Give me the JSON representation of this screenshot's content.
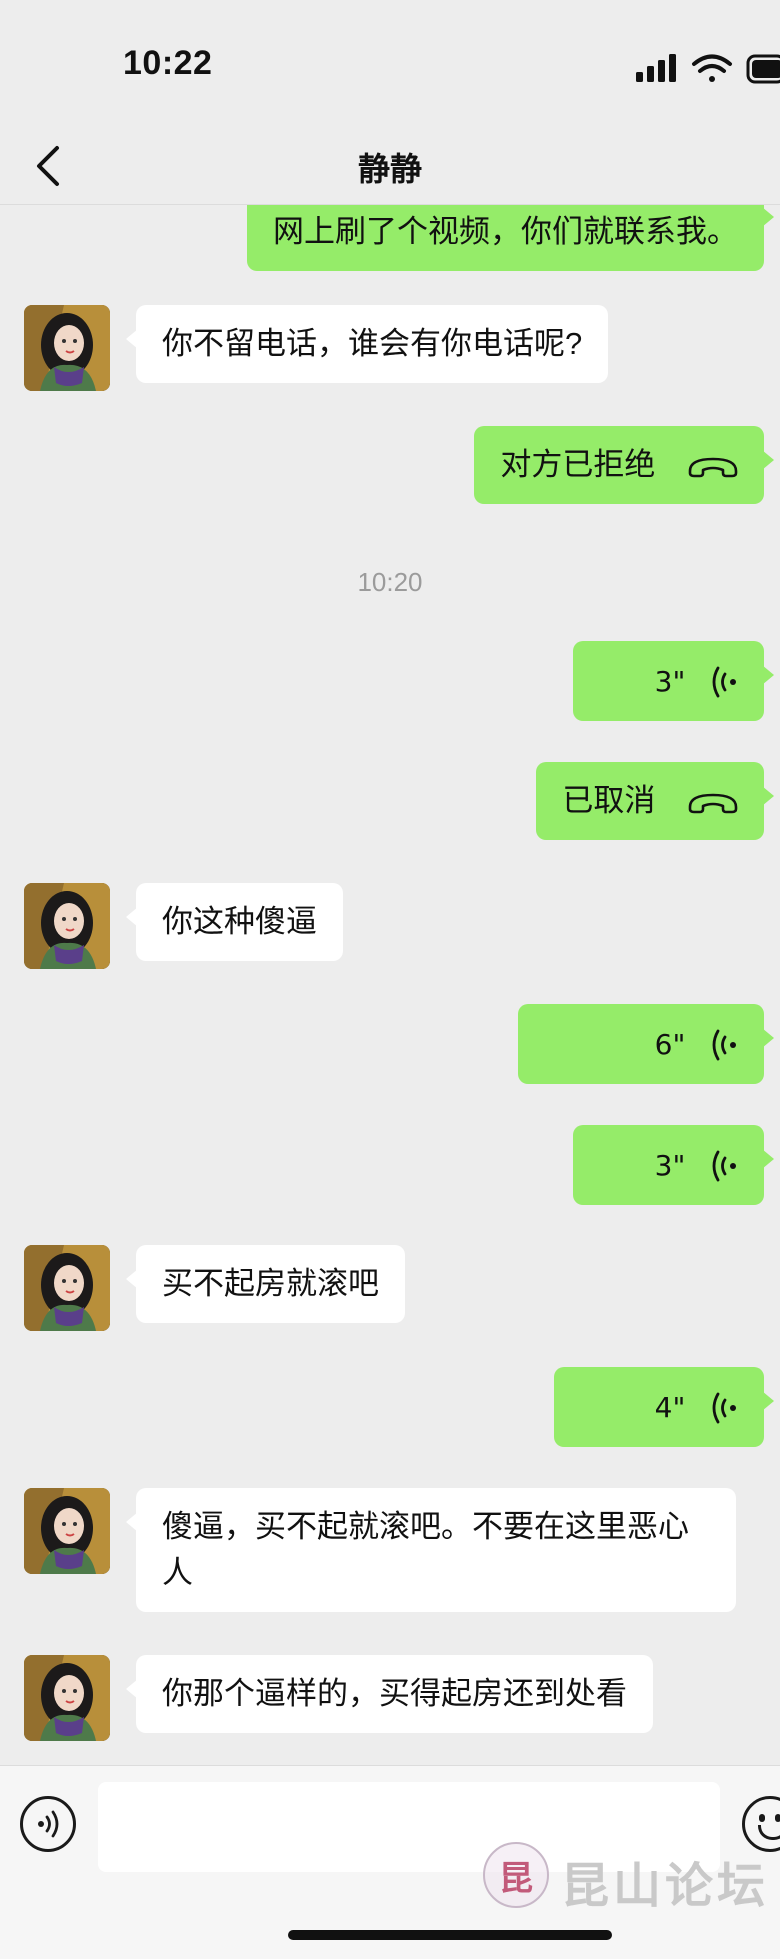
{
  "status_bar": {
    "time": "10:22"
  },
  "header": {
    "title": "静静"
  },
  "messages": [
    {
      "side": "sent",
      "kind": "text",
      "text": "网上刷了个视频，你们就联系我。"
    },
    {
      "side": "recv",
      "kind": "text",
      "text": "你不留电话，谁会有你电话呢?"
    },
    {
      "side": "sent",
      "kind": "call",
      "text": "对方已拒绝"
    },
    {
      "kind": "timestamp",
      "text": "10:20"
    },
    {
      "side": "sent",
      "kind": "voice",
      "text": "3\""
    },
    {
      "side": "sent",
      "kind": "call",
      "text": "已取消"
    },
    {
      "side": "recv",
      "kind": "text",
      "text": "你这种傻逼"
    },
    {
      "side": "sent",
      "kind": "voice",
      "text": "6\""
    },
    {
      "side": "sent",
      "kind": "voice",
      "text": "3\""
    },
    {
      "side": "recv",
      "kind": "text",
      "text": "买不起房就滚吧"
    },
    {
      "side": "sent",
      "kind": "voice",
      "text": "4\""
    },
    {
      "side": "recv",
      "kind": "text",
      "text": "傻逼，买不起就滚吧。不要在这里恶心人"
    },
    {
      "side": "recv",
      "kind": "text",
      "text": "你那个逼样的，买得起房还到处看"
    }
  ],
  "input": {
    "placeholder": ""
  },
  "icons": {
    "back": "chevron-left-icon",
    "call": "phone-hangup-icon",
    "voice_message": "voice-wave-icon",
    "voice_toggle": "voice-input-icon",
    "emoji": "emoji-smile-icon"
  },
  "colors": {
    "sent_bubble": "#95ec69",
    "recv_bubble": "#ffffff",
    "background": "#ededed"
  },
  "watermark": {
    "seal": "昆",
    "text": "昆山论坛"
  }
}
